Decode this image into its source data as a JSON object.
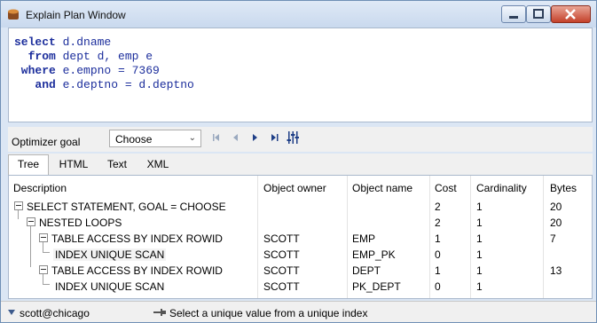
{
  "window": {
    "title": "Explain Plan Window"
  },
  "sql_lines": [
    {
      "kw": "select",
      "rest": " d.dname"
    },
    {
      "kw": "  from",
      "rest": " dept d, emp e"
    },
    {
      "kw": " where",
      "rest": " e.empno = 7369"
    },
    {
      "kw": "   and",
      "rest": " e.deptno = d.deptno"
    }
  ],
  "toolbar": {
    "optimizer_label": "Optimizer goal",
    "optimizer_value": "Choose"
  },
  "tabs": [
    "Tree",
    "HTML",
    "Text",
    "XML"
  ],
  "columns": [
    "Description",
    "Object owner",
    "Object name",
    "Cost",
    "Cardinality",
    "Bytes"
  ],
  "rows": [
    {
      "desc": "SELECT STATEMENT, GOAL = CHOOSE",
      "owner": "",
      "name": "",
      "cost": "2",
      "card": "1",
      "bytes": "20"
    },
    {
      "desc": "NESTED LOOPS",
      "owner": "",
      "name": "",
      "cost": "2",
      "card": "1",
      "bytes": "20"
    },
    {
      "desc": "TABLE ACCESS BY INDEX ROWID",
      "owner": "SCOTT",
      "name": "EMP",
      "cost": "1",
      "card": "1",
      "bytes": "7"
    },
    {
      "desc": "INDEX UNIQUE SCAN",
      "owner": "SCOTT",
      "name": "EMP_PK",
      "cost": "0",
      "card": "1",
      "bytes": ""
    },
    {
      "desc": "TABLE ACCESS BY INDEX ROWID",
      "owner": "SCOTT",
      "name": "DEPT",
      "cost": "1",
      "card": "1",
      "bytes": "13"
    },
    {
      "desc": "INDEX UNIQUE SCAN",
      "owner": "SCOTT",
      "name": "PK_DEPT",
      "cost": "0",
      "card": "1",
      "bytes": ""
    }
  ],
  "status": {
    "connection": "scott@chicago",
    "message": "Select a unique value from a unique index"
  }
}
